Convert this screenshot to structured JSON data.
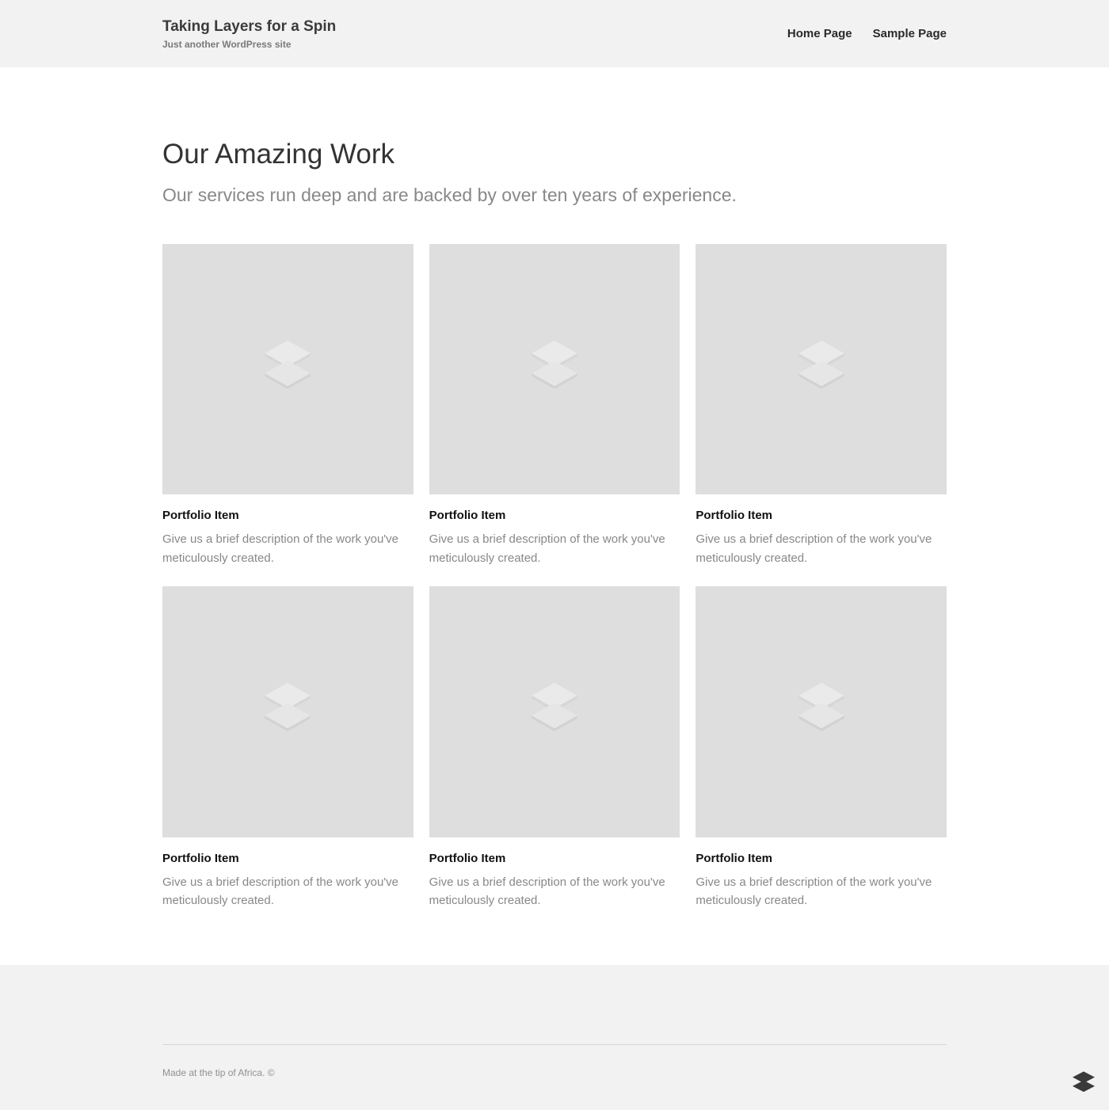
{
  "header": {
    "site_title": "Taking Layers for a Spin",
    "tagline": "Just another WordPress site",
    "nav": [
      {
        "label": "Home Page"
      },
      {
        "label": "Sample Page"
      }
    ]
  },
  "main": {
    "title": "Our Amazing Work",
    "subtitle": "Our services run deep and are backed by over ten years of experience.",
    "items": [
      {
        "title": "Portfolio Item",
        "desc": "Give us a brief description of the work you've meticulously created."
      },
      {
        "title": "Portfolio Item",
        "desc": "Give us a brief description of the work you've meticulously created."
      },
      {
        "title": "Portfolio Item",
        "desc": "Give us a brief description of the work you've meticulously created."
      },
      {
        "title": "Portfolio Item",
        "desc": "Give us a brief description of the work you've meticulously created."
      },
      {
        "title": "Portfolio Item",
        "desc": "Give us a brief description of the work you've meticulously created."
      },
      {
        "title": "Portfolio Item",
        "desc": "Give us a brief description of the work you've meticulously created."
      }
    ]
  },
  "footer": {
    "credit": "Made at the tip of Africa. ©"
  }
}
